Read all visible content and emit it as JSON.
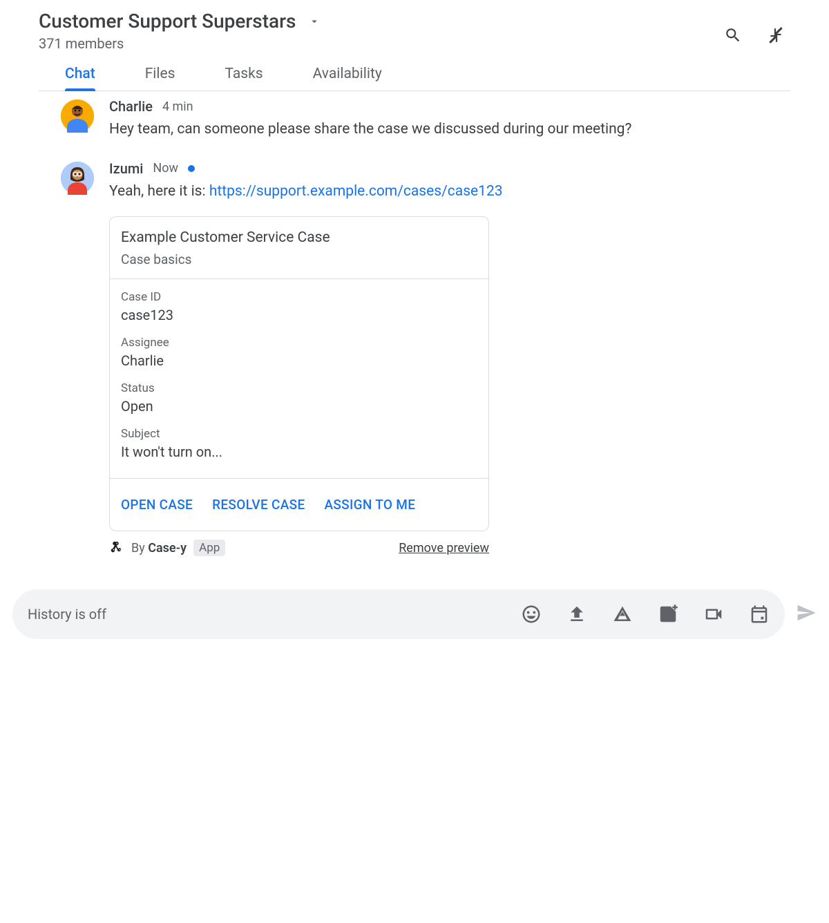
{
  "header": {
    "title": "Customer Support Superstars",
    "members": "371 members"
  },
  "tabs": [
    {
      "label": "Chat",
      "active": true
    },
    {
      "label": "Files",
      "active": false
    },
    {
      "label": "Tasks",
      "active": false
    },
    {
      "label": "Availability",
      "active": false
    }
  ],
  "messages": [
    {
      "author": "Charlie",
      "time": "4 min",
      "text": "Hey team, can someone please share the case we discussed during our meeting?"
    },
    {
      "author": "Izumi",
      "time": "Now",
      "unread": true,
      "text_prefix": "Yeah, here it is: ",
      "link_text": "https://support.example.com/cases/case123"
    }
  ],
  "card": {
    "title": "Example Customer Service Case",
    "subtitle": "Case basics",
    "fields": [
      {
        "label": "Case ID",
        "value": "case123"
      },
      {
        "label": "Assignee",
        "value": "Charlie"
      },
      {
        "label": "Status",
        "value": "Open"
      },
      {
        "label": "Subject",
        "value": "It won't turn on..."
      }
    ],
    "actions": [
      "OPEN CASE",
      "RESOLVE CASE",
      "ASSIGN TO ME"
    ],
    "by_prefix": "By ",
    "by_name": "Case-y",
    "app_badge": "App",
    "remove_label": "Remove preview"
  },
  "composer": {
    "placeholder": "History is off"
  }
}
